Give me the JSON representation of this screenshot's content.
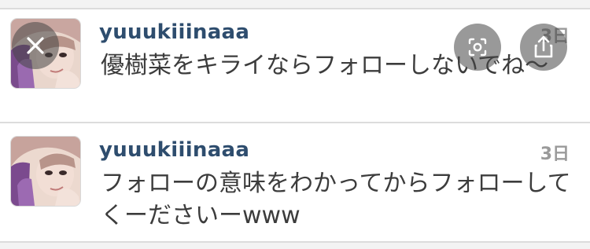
{
  "posts": [
    {
      "username": "yuuukiiinaaa",
      "time": "3日",
      "text": "優樹菜をキライならフォローしないでね〜"
    },
    {
      "username": "yuuukiiinaaa",
      "time": "3日",
      "text": "フォローの意味をわかってからフォローしてくーださいーwww"
    }
  ],
  "overlay": {
    "close_icon": "close-icon",
    "lens_icon": "lens-icon",
    "share_icon": "share-icon"
  },
  "colors": {
    "username": "#2e4d6e",
    "text": "#3c3c3c",
    "time": "#9a9a9a"
  }
}
